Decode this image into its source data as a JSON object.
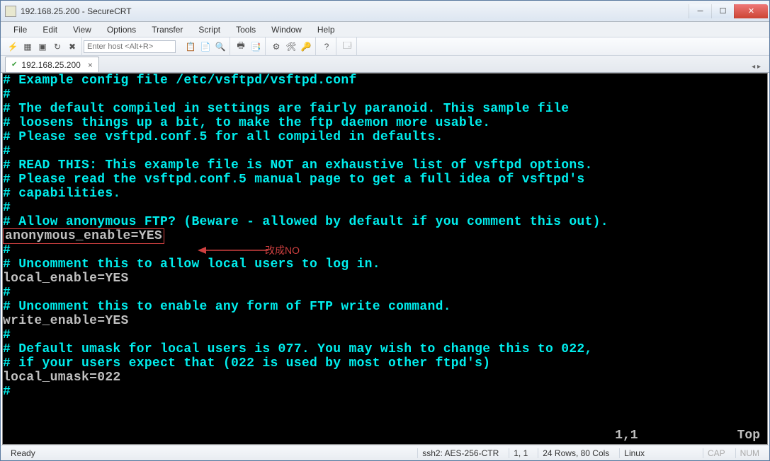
{
  "window": {
    "title": "192.168.25.200 - SecureCRT"
  },
  "menus": {
    "file": "File",
    "edit": "Edit",
    "view": "View",
    "options": "Options",
    "transfer": "Transfer",
    "script": "Script",
    "tools": "Tools",
    "window": "Window",
    "help": "Help"
  },
  "toolbar": {
    "host_placeholder": "Enter host <Alt+R>"
  },
  "tab": {
    "label": "192.168.25.200",
    "close": "×"
  },
  "terminal": {
    "lines": [
      "# Example config file /etc/vsftpd/vsftpd.conf",
      "#",
      "# The default compiled in settings are fairly paranoid. This sample file",
      "# loosens things up a bit, to make the ftp daemon more usable.",
      "# Please see vsftpd.conf.5 for all compiled in defaults.",
      "#",
      "# READ THIS: This example file is NOT an exhaustive list of vsftpd options.",
      "# Please read the vsftpd.conf.5 manual page to get a full idea of vsftpd's",
      "# capabilities.",
      "#",
      "# Allow anonymous FTP? (Beware - allowed by default if you comment this out).",
      "anonymous_enable=YES",
      "#",
      "# Uncomment this to allow local users to log in.",
      "local_enable=YES",
      "#",
      "# Uncomment this to enable any form of FTP write command.",
      "write_enable=YES",
      "#",
      "# Default umask for local users is 077. You may wish to change this to 022,",
      "# if your users expect that (022 is used by most other ftpd's)",
      "local_umask=022",
      "#"
    ],
    "annotation": "改成NO",
    "status_pos": "1,1",
    "status_top": "Top"
  },
  "status": {
    "ready": "Ready",
    "cipher": "ssh2: AES-256-CTR",
    "cursor": "1,  1",
    "size": "24 Rows, 80 Cols",
    "emu": "Linux",
    "cap": "CAP",
    "num": "NUM"
  }
}
